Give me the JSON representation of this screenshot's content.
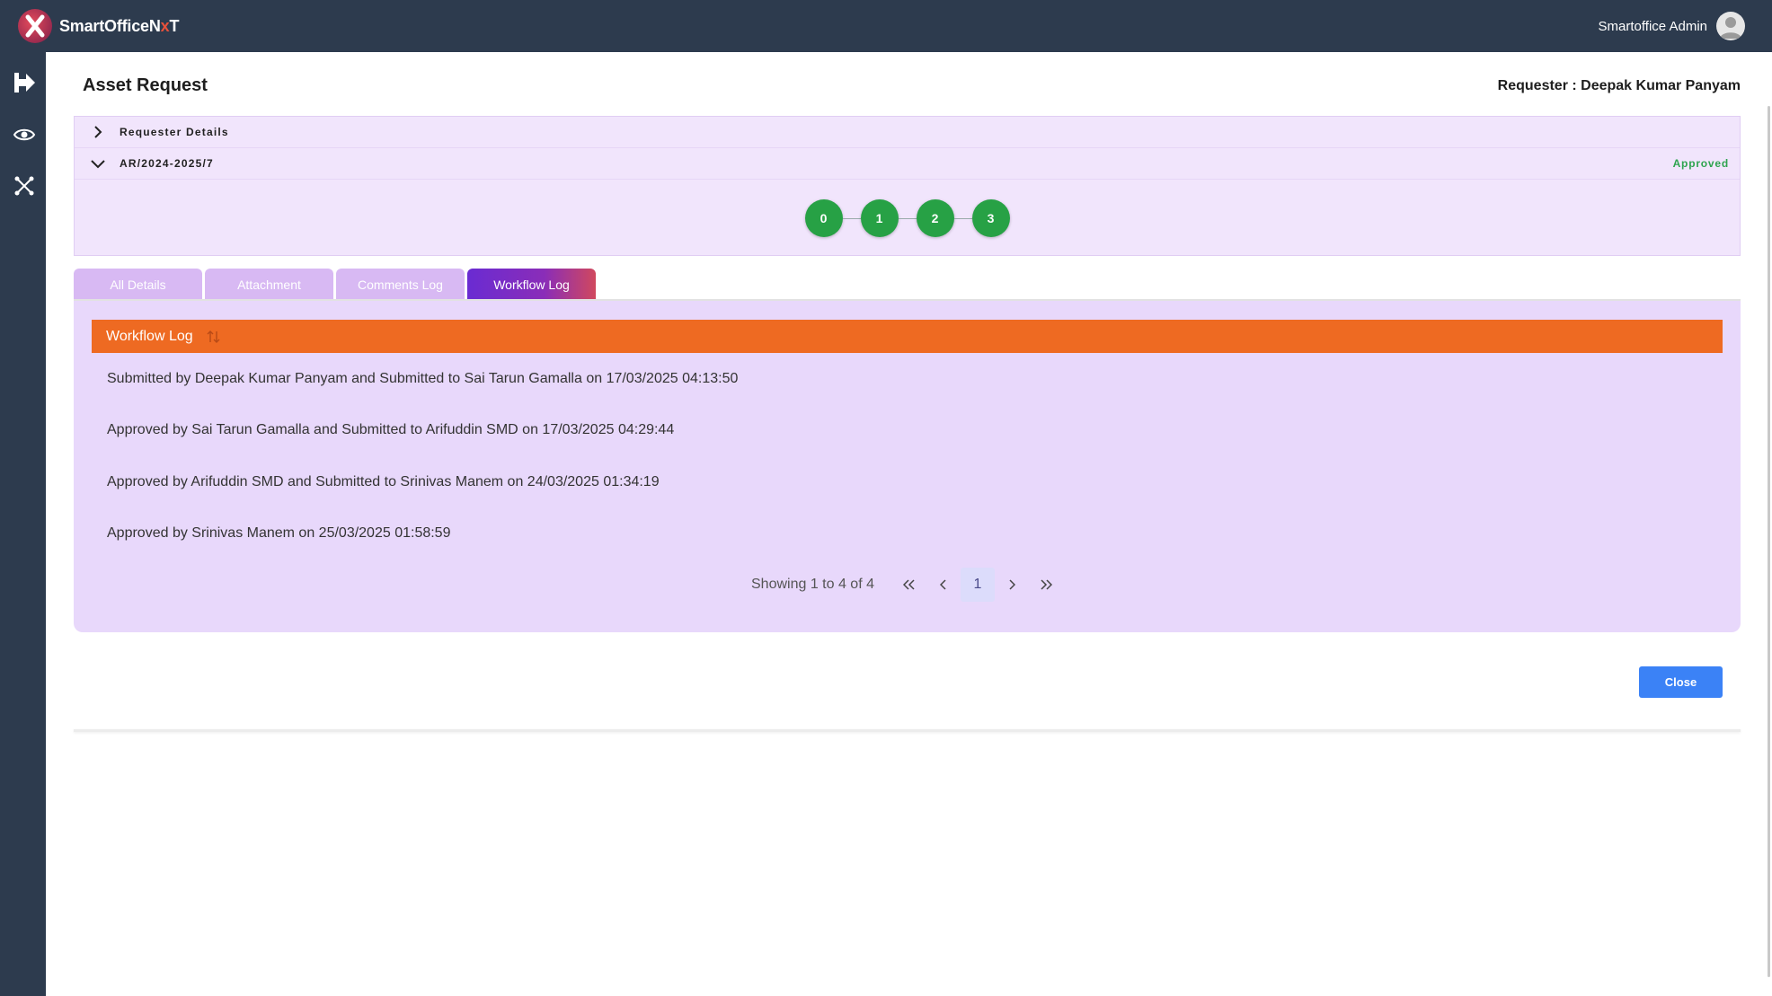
{
  "app": {
    "logo_text_prefix": "SmartOfficeN",
    "logo_text_x": "x",
    "logo_text_suffix": "T",
    "user_name": "Smartoffice Admin"
  },
  "sidebar": {
    "items": [
      {
        "icon": "exit-icon"
      },
      {
        "icon": "eye-icon"
      },
      {
        "icon": "network-icon"
      }
    ]
  },
  "page": {
    "title": "Asset Request",
    "requester": "Requester : Deepak Kumar Panyam"
  },
  "accordion": {
    "requester_details_label": "Requester Details",
    "request_id": "AR/2024-2025/7",
    "status": "Approved",
    "status_color": "#2ea44f"
  },
  "workflow_steps": [
    "0",
    "1",
    "2",
    "3"
  ],
  "tabs": [
    {
      "label": "All Details",
      "active": false
    },
    {
      "label": "Attachment",
      "active": false
    },
    {
      "label": "Comments Log",
      "active": false
    },
    {
      "label": "Workflow Log",
      "active": true
    }
  ],
  "workflow_log": {
    "title": "Workflow Log",
    "header_color": "#ee6a22",
    "entries": [
      "Submitted by Deepak Kumar Panyam and Submitted to Sai Tarun Gamalla on 17/03/2025 04:13:50",
      "Approved by Sai Tarun Gamalla and Submitted to Arifuddin SMD on 17/03/2025 04:29:44",
      "Approved by Arifuddin SMD and Submitted to Srinivas Manem on 24/03/2025 01:34:19",
      "Approved by Srinivas Manem on 25/03/2025 01:58:59"
    ]
  },
  "pagination": {
    "info": "Showing 1 to 4 of 4",
    "current_page": "1"
  },
  "actions": {
    "close_label": "Close"
  }
}
